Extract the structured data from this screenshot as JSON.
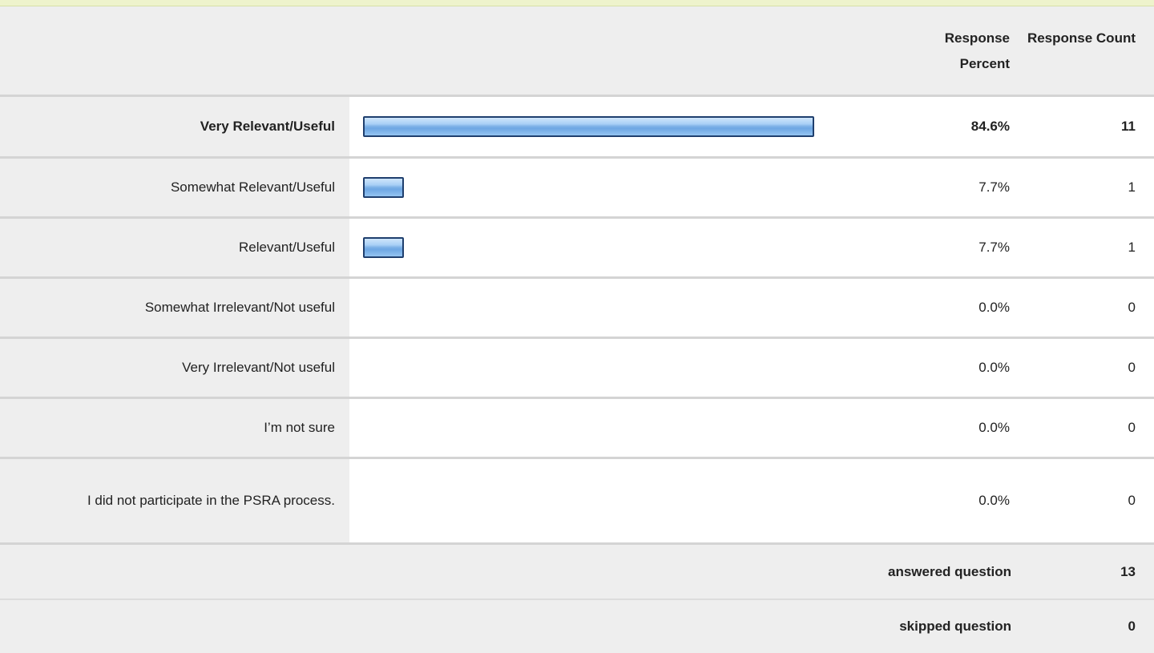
{
  "header": {
    "percent_label": "Response Percent",
    "count_label": "Response Count"
  },
  "rows": [
    {
      "label": "Very Relevant/Useful",
      "percent": "84.6%",
      "count": "11"
    },
    {
      "label": "Somewhat Relevant/Useful",
      "percent": "7.7%",
      "count": "1"
    },
    {
      "label": "Relevant/Useful",
      "percent": "7.7%",
      "count": "1"
    },
    {
      "label": "Somewhat Irrelevant/Not useful",
      "percent": "0.0%",
      "count": "0"
    },
    {
      "label": "Very Irrelevant/Not useful",
      "percent": "0.0%",
      "count": "0"
    },
    {
      "label": "I’m not sure",
      "percent": "0.0%",
      "count": "0"
    },
    {
      "label": "I did not participate in the PSRA process.",
      "percent": "0.0%",
      "count": "0"
    }
  ],
  "footer": {
    "answered_label": "answered question",
    "answered_value": "13",
    "skipped_label": "skipped question",
    "skipped_value": "0"
  },
  "chart_data": {
    "type": "bar",
    "categories": [
      "Very Relevant/Useful",
      "Somewhat Relevant/Useful",
      "Relevant/Useful",
      "Somewhat Irrelevant/Not useful",
      "Very Irrelevant/Not useful",
      "I’m not sure",
      "I did not participate in the PSRA process."
    ],
    "values": [
      84.6,
      7.7,
      7.7,
      0.0,
      0.0,
      0.0,
      0.0
    ],
    "counts": [
      11,
      1,
      1,
      0,
      0,
      0,
      0
    ],
    "xlim": [
      0,
      100
    ]
  },
  "colors": {
    "bar_fill": "#8fc0ee",
    "bar_border": "#1f3f6e",
    "label_background": "#eeeeee",
    "top_accent": "#eef3cc"
  }
}
